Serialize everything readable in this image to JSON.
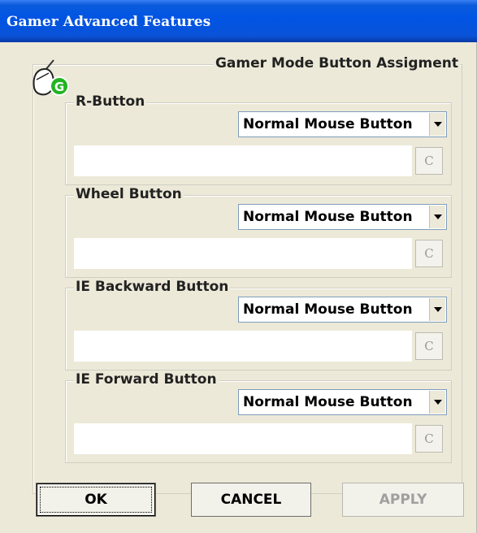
{
  "window": {
    "title": "Gamer Advanced Features"
  },
  "main_group": {
    "legend": "Gamer Mode Button Assigment",
    "icon": "gamer-mouse-icon"
  },
  "groups": [
    {
      "label": "R-Button",
      "selected": "Normal Mouse Button",
      "field_value": "",
      "clear_label": "C"
    },
    {
      "label": "Wheel Button",
      "selected": "Normal Mouse Button",
      "field_value": "",
      "clear_label": "C"
    },
    {
      "label": "IE Backward Button",
      "selected": "Normal Mouse Button",
      "field_value": "",
      "clear_label": "C"
    },
    {
      "label": "IE Forward Button",
      "selected": "Normal Mouse Button",
      "field_value": "",
      "clear_label": "C"
    }
  ],
  "buttons": {
    "ok": "OK",
    "cancel": "CANCEL",
    "apply": "APPLY"
  },
  "colors": {
    "titlebar": "#0054e3",
    "dialog_bg": "#ece9d8",
    "icon_green": "#22b422"
  }
}
